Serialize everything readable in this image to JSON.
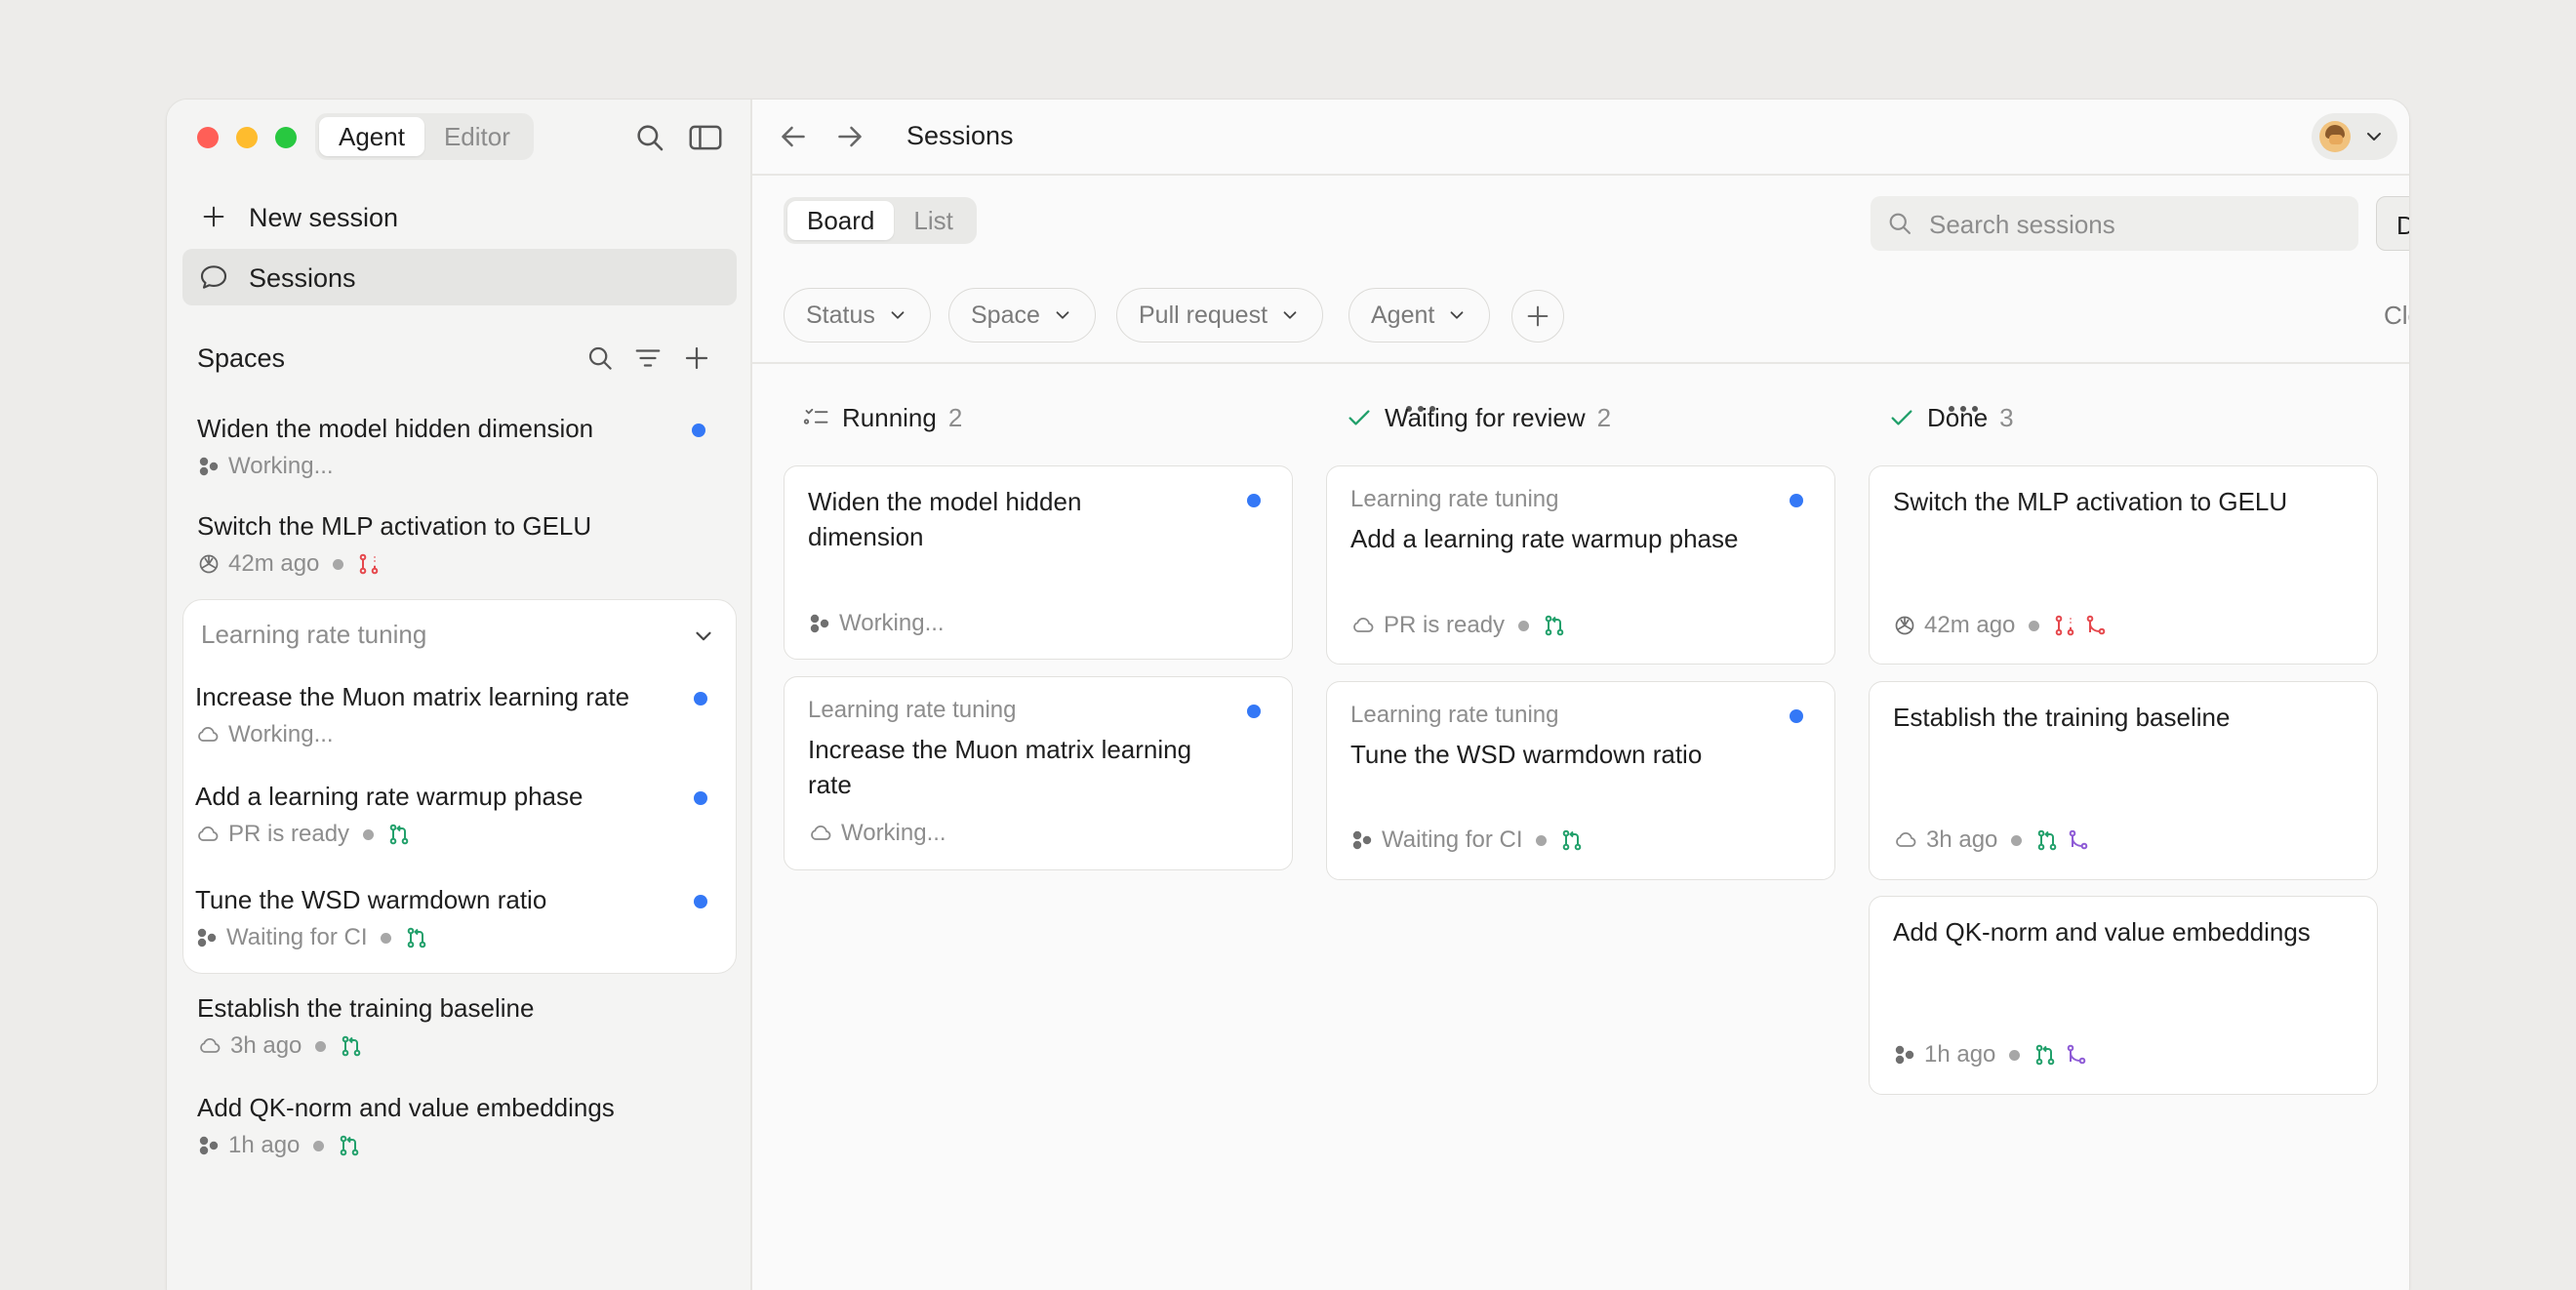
{
  "sidebar": {
    "mode_tabs": [
      "Agent",
      "Editor"
    ],
    "active_mode": "Agent",
    "new_session_label": "New session",
    "sessions_label": "Sessions",
    "spaces_label": "Spaces",
    "items_top": [
      {
        "title": "Widen the model hidden dimension",
        "status_icon": "agent-icon",
        "status": "Working...",
        "unread": true
      },
      {
        "title": "Switch the MLP activation to GELU",
        "status_icon": "openai-icon",
        "status": "42m ago",
        "unread": false
      }
    ],
    "group": {
      "name": "Learning rate tuning",
      "items": [
        {
          "title": "Increase the Muon matrix learning rate",
          "status_icon": "cloud-icon",
          "status": "Working...",
          "unread": true
        },
        {
          "title": "Add a learning rate warmup phase",
          "status_icon": "cloud-icon",
          "status": "PR is ready",
          "unread": true
        },
        {
          "title": "Tune the WSD warmdown ratio",
          "status_icon": "agent-icon",
          "status": "Waiting for CI",
          "unread": true
        }
      ]
    },
    "items_bottom": [
      {
        "title": "Establish the training baseline",
        "status_icon": "cloud-icon",
        "status": "3h ago"
      },
      {
        "title": "Add QK-norm and value embeddings",
        "status_icon": "agent-icon",
        "status": "1h ago"
      }
    ]
  },
  "header": {
    "title": "Sessions"
  },
  "toolbar": {
    "views": [
      "Board",
      "List"
    ],
    "active_view": "Board",
    "search_placeholder": "Search sessions",
    "display_label": "Display",
    "filters": [
      "Status",
      "Space",
      "Pull request",
      "Agent"
    ],
    "clear_filters_label": "Clear filters"
  },
  "board": {
    "columns": [
      {
        "name": "Running",
        "count": "2",
        "icon": "checklist-icon",
        "cards": [
          {
            "space": "",
            "title_lines": [
              "Widen the model hidden",
              "dimension"
            ],
            "status_icon": "agent-icon",
            "status": "Working...",
            "unread": true
          },
          {
            "space": "Learning rate tuning",
            "title_lines": [
              "Increase the Muon matrix learning",
              "rate"
            ],
            "status_icon": "cloud-icon",
            "status": "Working...",
            "unread": true
          }
        ]
      },
      {
        "name": "Waiting for review",
        "count": "2",
        "icon": "check-icon",
        "cards": [
          {
            "space": "Learning rate tuning",
            "title_lines": [
              "Add a learning rate warmup phase"
            ],
            "status_icon": "cloud-icon",
            "status": "PR is ready",
            "unread": true
          },
          {
            "space": "Learning rate tuning",
            "title_lines": [
              "Tune the WSD warmdown ratio"
            ],
            "status_icon": "agent-icon",
            "status": "Waiting for CI",
            "unread": true
          }
        ]
      },
      {
        "name": "Done",
        "count": "3",
        "icon": "check-icon",
        "cards": [
          {
            "space": "",
            "title_lines": [
              "Switch the MLP activation to GELU"
            ],
            "status_icon": "openai-icon",
            "status": "42m ago"
          },
          {
            "space": "",
            "title_lines": [
              "Establish the training baseline"
            ],
            "status_icon": "cloud-icon",
            "status": "3h ago"
          },
          {
            "space": "",
            "title_lines": [
              "Add QK-norm and value embeddings"
            ],
            "status_icon": "agent-icon",
            "status": "1h ago"
          }
        ]
      }
    ]
  },
  "colors": {
    "accent_blue": "#3478f6",
    "pr_green": "#22a06b",
    "pr_red": "#e5484d",
    "merged_purple": "#8e5bd6",
    "check_green": "#22a06b"
  }
}
